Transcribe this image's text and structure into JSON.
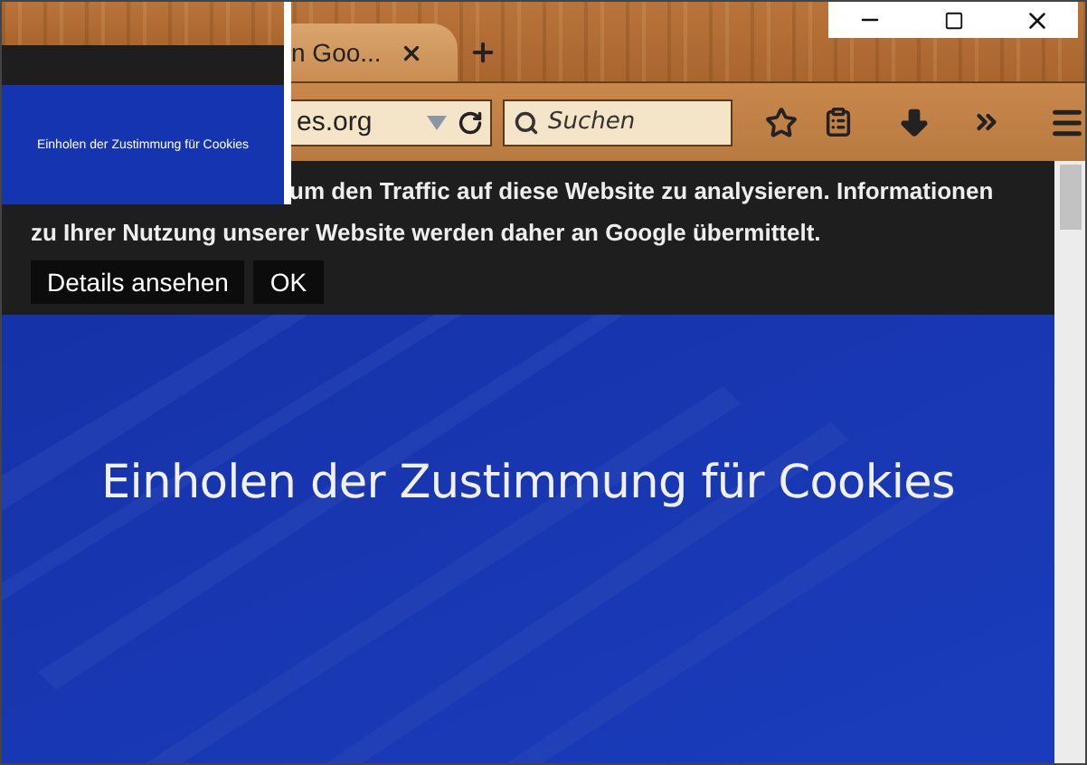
{
  "tab": {
    "title": "n Goo..."
  },
  "address_bar": {
    "value": "es.org"
  },
  "search": {
    "placeholder": "Suchen"
  },
  "cookie_notice": {
    "text": "um den Traffic auf diese Website zu analysieren. Informationen zu Ihrer Nutzung unserer Website werden daher an Google übermittelt.",
    "buttons": [
      "Details ansehen",
      "OK"
    ]
  },
  "hero": {
    "heading": "Einholen der Zustimmung für Cookies"
  },
  "thumbnail": {
    "heading": "Einholen der Zustimmung für Cookies"
  }
}
